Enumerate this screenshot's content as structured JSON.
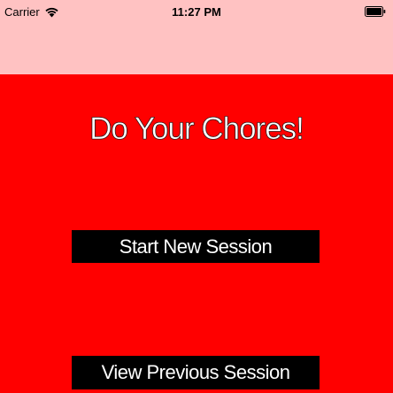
{
  "status_bar": {
    "carrier": "Carrier",
    "time": "11:27 PM",
    "wifi_icon": "wifi-icon",
    "battery_icon": "battery-full-icon"
  },
  "colors": {
    "background": "#ff0000",
    "nav_bar": "#ffc2c2",
    "button_bg": "#000000",
    "button_text": "#ffffff",
    "title_text": "#ffffff"
  },
  "main": {
    "title": "Do Your Chores!",
    "start_button_label": "Start New Session",
    "previous_button_label": "View Previous Session"
  }
}
